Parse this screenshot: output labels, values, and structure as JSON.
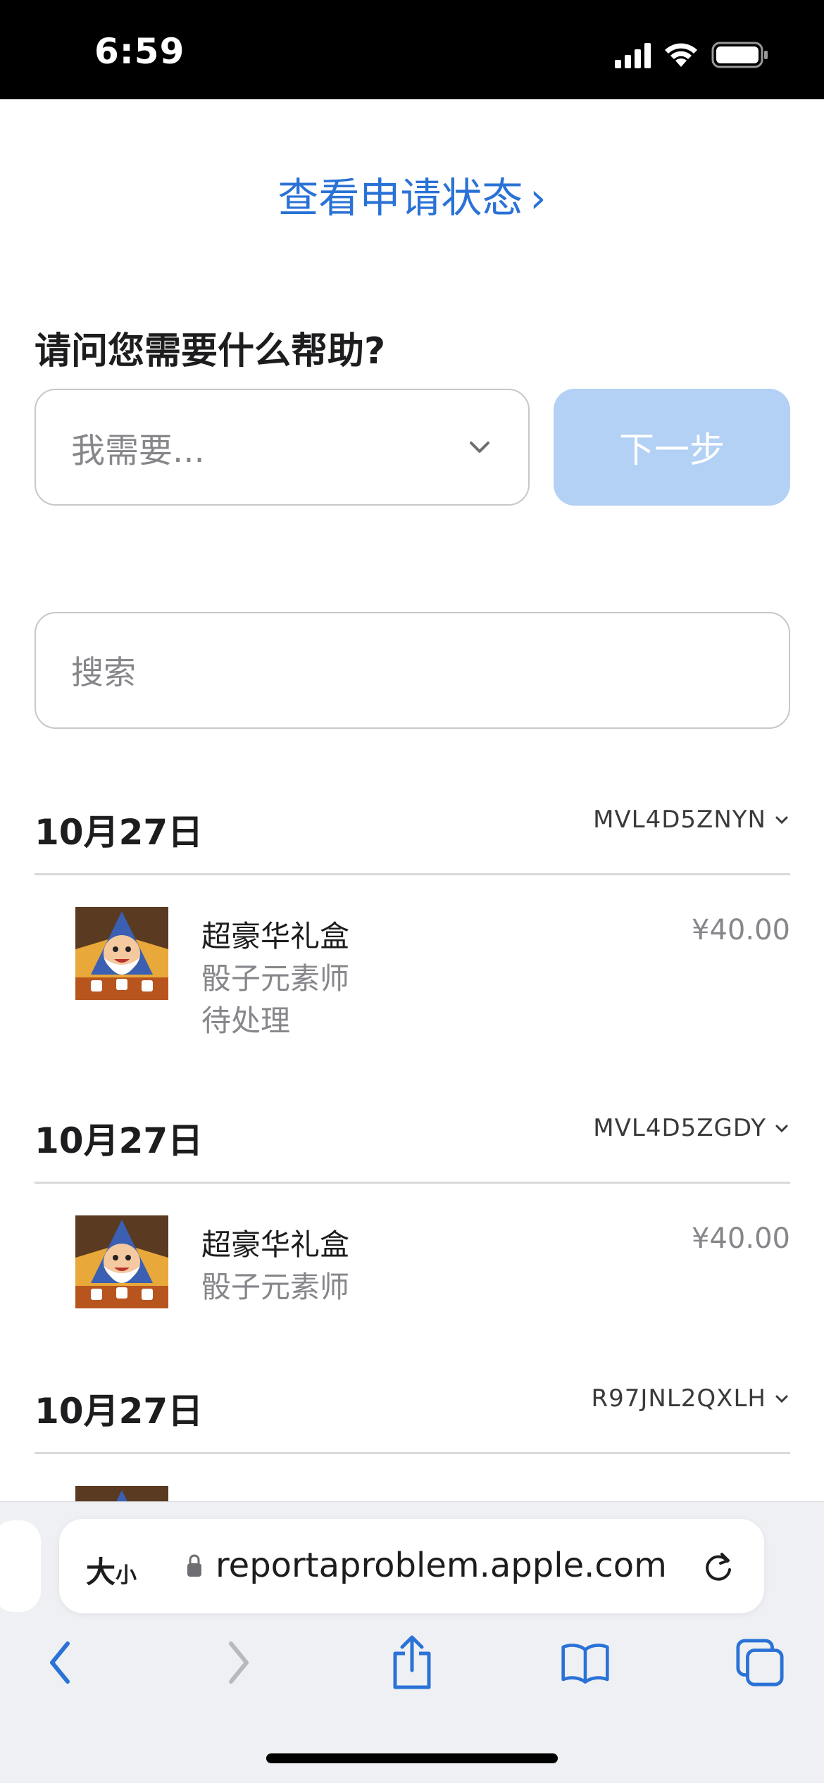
{
  "status_bar": {
    "time": "6:59"
  },
  "status_link": {
    "label": "查看申请状态",
    "chevron": "›"
  },
  "help": {
    "title": "请问您需要什么帮助?",
    "select_placeholder": "我需要...",
    "next_label": "下一步"
  },
  "search": {
    "placeholder": "搜索"
  },
  "orders": [
    {
      "date": "10月27日",
      "order_id": "MVL4D5ZNYN",
      "item": {
        "name": "超豪华礼盒",
        "app": "骰子元素师",
        "status": "待处理",
        "price": "¥40.00"
      }
    },
    {
      "date": "10月27日",
      "order_id": "MVL4D5ZGDY",
      "item": {
        "name": "超豪华礼盒",
        "app": "骰子元素师",
        "price": "¥40.00"
      }
    },
    {
      "date": "10月27日",
      "order_id": "R97JNL2QXLH"
    }
  ],
  "browser": {
    "text_size_label": "大",
    "text_size_small": "小",
    "url": "reportaproblem.apple.com"
  },
  "colors": {
    "accent": "#2a72d6",
    "next_disabled": "#b3d1f4"
  },
  "icons": [
    "signal-icon",
    "wifi-icon",
    "battery-icon",
    "chevron-down-icon",
    "lock-icon",
    "reload-icon",
    "back-icon",
    "forward-icon",
    "share-icon",
    "bookmarks-icon",
    "tabs-icon"
  ]
}
